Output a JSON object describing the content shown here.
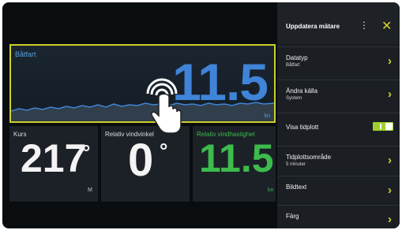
{
  "speed_tile": {
    "label": "Båtfart",
    "value": "11.5",
    "unit": "kn"
  },
  "course_tile": {
    "label": "Kurs",
    "value": "217",
    "degree": "°",
    "unit": "M"
  },
  "wind_angle_tile": {
    "label": "Relativ vindvinkel",
    "value": "0",
    "degree": "°"
  },
  "wind_speed_tile": {
    "label": "Relativ vindhastighet",
    "value": "11.5",
    "unit": "kn"
  },
  "panel": {
    "title": "Uppdatera mätare",
    "kebab": "⋮",
    "close": "✕",
    "items": [
      {
        "title": "Datatyp",
        "sub": "Båtfart"
      },
      {
        "title": "Ändra källa",
        "sub": "System"
      },
      {
        "title": "Visa tidplott"
      },
      {
        "title": "Tidplottsområde",
        "sub": "5 minuter"
      },
      {
        "title": "Bildtext"
      },
      {
        "title": "Färg"
      }
    ],
    "chevron": "›",
    "toggle_on": true
  },
  "colors": {
    "accent_yellow": "#d7d42c",
    "speed_blue": "#3f84d8",
    "wind_green": "#3dbb4c",
    "toggle_green": "#9fcf2e"
  }
}
